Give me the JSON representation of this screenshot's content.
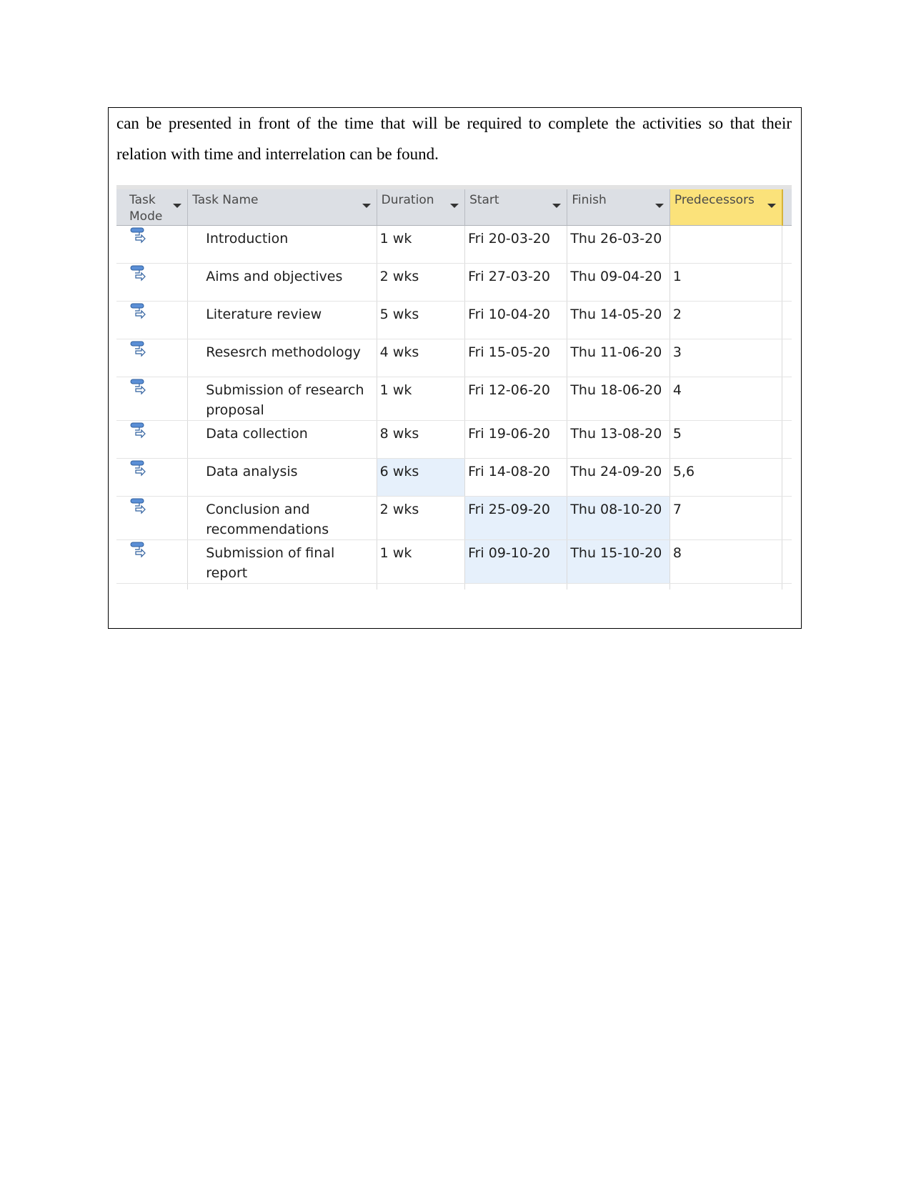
{
  "paragraph": "can be presented in front of the time that will be required to complete the activities so that their relation with time and interrelation can be found.",
  "table": {
    "headers": {
      "task_mode": "Task Mode",
      "task_name": "Task Name",
      "duration": "Duration",
      "start": "Start",
      "finish": "Finish",
      "predecessors": "Predecessors"
    },
    "highlight_color": "#fbe27a",
    "selected_cell_color": "#e6f0fb",
    "task_mode_icon": "auto-scheduled-task-icon",
    "rows": [
      {
        "name": "Introduction",
        "duration": "1 wk",
        "start": "Fri 20-03-20",
        "finish": "Thu 26-03-20",
        "predecessors": ""
      },
      {
        "name": "Aims and objectives",
        "duration": "2 wks",
        "start": "Fri 27-03-20",
        "finish": "Thu 09-04-20",
        "predecessors": "1"
      },
      {
        "name": "Literature review",
        "duration": "5 wks",
        "start": "Fri 10-04-20",
        "finish": "Thu 14-05-20",
        "predecessors": "2"
      },
      {
        "name": "Resesrch methodology",
        "duration": "4 wks",
        "start": "Fri 15-05-20",
        "finish": "Thu 11-06-20",
        "predecessors": "3"
      },
      {
        "name": "Submission of research proposal",
        "duration": "1 wk",
        "start": "Fri 12-06-20",
        "finish": "Thu 18-06-20",
        "predecessors": "4"
      },
      {
        "name": "Data collection",
        "duration": "8 wks",
        "start": "Fri 19-06-20",
        "finish": "Thu 13-08-20",
        "predecessors": "5"
      },
      {
        "name": "Data analysis",
        "duration": "6 wks",
        "start": "Fri 14-08-20",
        "finish": "Thu 24-09-20",
        "predecessors": "5,6"
      },
      {
        "name": "Conclusion and recommendations",
        "duration": "2 wks",
        "start": "Fri 25-09-20",
        "finish": "Thu 08-10-20",
        "predecessors": "7"
      },
      {
        "name": "Submission of final report",
        "duration": "1 wk",
        "start": "Fri 09-10-20",
        "finish": "Thu 15-10-20",
        "predecessors": "8"
      }
    ]
  }
}
